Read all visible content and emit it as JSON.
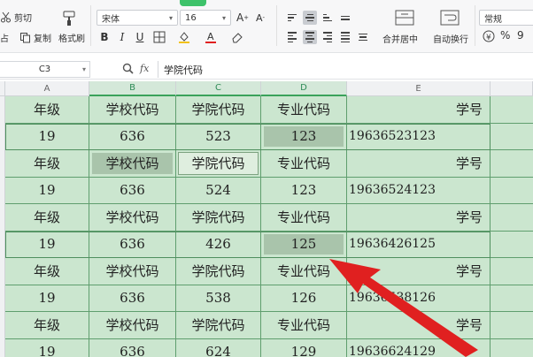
{
  "ribbon": {
    "cut": "剪切",
    "copy": "复制",
    "paste_prefix": "占",
    "format_painter": "格式刷",
    "font_name": "宋体",
    "font_size": "16",
    "merge_center": "合并居中",
    "wrap_text": "自动换行",
    "number_format": "常规",
    "percent": "%",
    "thousands": "9"
  },
  "formula_bar": {
    "cell_ref": "C3",
    "fx_label": "fx",
    "content": "学院代码"
  },
  "columns": [
    "A",
    "B",
    "C",
    "D",
    "E"
  ],
  "rows": [
    [
      "年级",
      "学校代码",
      "学院代码",
      "专业代码",
      "学号"
    ],
    [
      "19",
      "636",
      "523",
      "123",
      "19636523123"
    ],
    [
      "年级",
      "学校代码",
      "学院代码",
      "专业代码",
      "学号"
    ],
    [
      "19",
      "636",
      "524",
      "123",
      "19636524123"
    ],
    [
      "年级",
      "学校代码",
      "学院代码",
      "专业代码",
      "学号"
    ],
    [
      "19",
      "636",
      "426",
      "125",
      "19636426125"
    ],
    [
      "年级",
      "学校代码",
      "学院代码",
      "专业代码",
      "学号"
    ],
    [
      "19",
      "636",
      "538",
      "126",
      "19636538126"
    ],
    [
      "年级",
      "学校代码",
      "学院代码",
      "专业代码",
      "学号"
    ],
    [
      "19",
      "636",
      "624",
      "129",
      "19636624129"
    ]
  ],
  "highlighted_cells": [
    [
      1,
      3
    ],
    [
      2,
      1
    ],
    [
      5,
      3
    ]
  ],
  "outlined_rows": [
    1,
    5
  ],
  "outlined_cell": [
    2,
    2
  ],
  "colors": {
    "grid_bg": "#cbe6cf",
    "grid_line": "#5f9e6e",
    "highlight": "#a9c4ab",
    "arrow": "#e02020",
    "accent_green": "#3ec26a"
  }
}
